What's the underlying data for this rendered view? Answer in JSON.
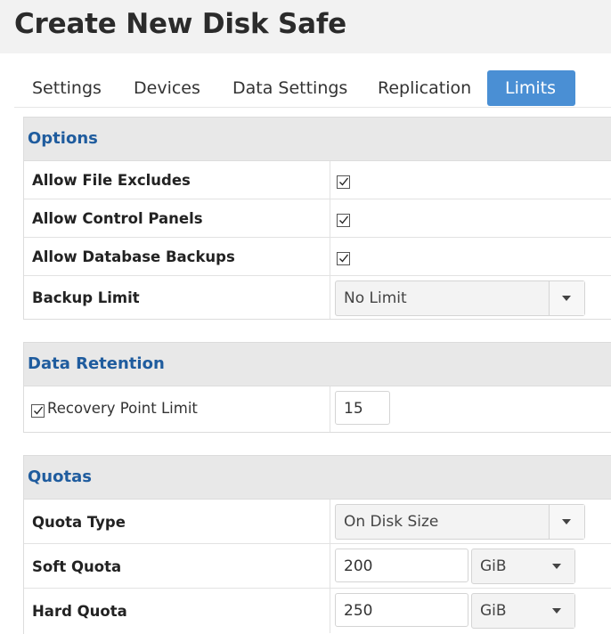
{
  "page": {
    "title": "Create New Disk Safe"
  },
  "tabs": [
    {
      "label": "Settings",
      "active": false
    },
    {
      "label": "Devices",
      "active": false
    },
    {
      "label": "Data Settings",
      "active": false
    },
    {
      "label": "Replication",
      "active": false
    },
    {
      "label": "Limits",
      "active": true
    }
  ],
  "options": {
    "heading": "Options",
    "allow_file_excludes": {
      "label": "Allow File Excludes",
      "checked": true
    },
    "allow_control_panels": {
      "label": "Allow Control Panels",
      "checked": true
    },
    "allow_database_backups": {
      "label": "Allow Database Backups",
      "checked": true
    },
    "backup_limit": {
      "label": "Backup Limit",
      "value": "No Limit"
    }
  },
  "data_retention": {
    "heading": "Data Retention",
    "recovery_point_limit": {
      "label": "Recovery Point Limit",
      "checked": true,
      "value": "15"
    }
  },
  "quotas": {
    "heading": "Quotas",
    "quota_type": {
      "label": "Quota Type",
      "value": "On Disk Size"
    },
    "soft_quota": {
      "label": "Soft Quota",
      "value": "200",
      "unit": "GiB"
    },
    "hard_quota": {
      "label": "Hard Quota",
      "value": "250",
      "unit": "GiB"
    }
  },
  "colors": {
    "accent": "#4a8fd4",
    "heading": "#1f5c9e",
    "section_bg": "#e8e8e8"
  }
}
